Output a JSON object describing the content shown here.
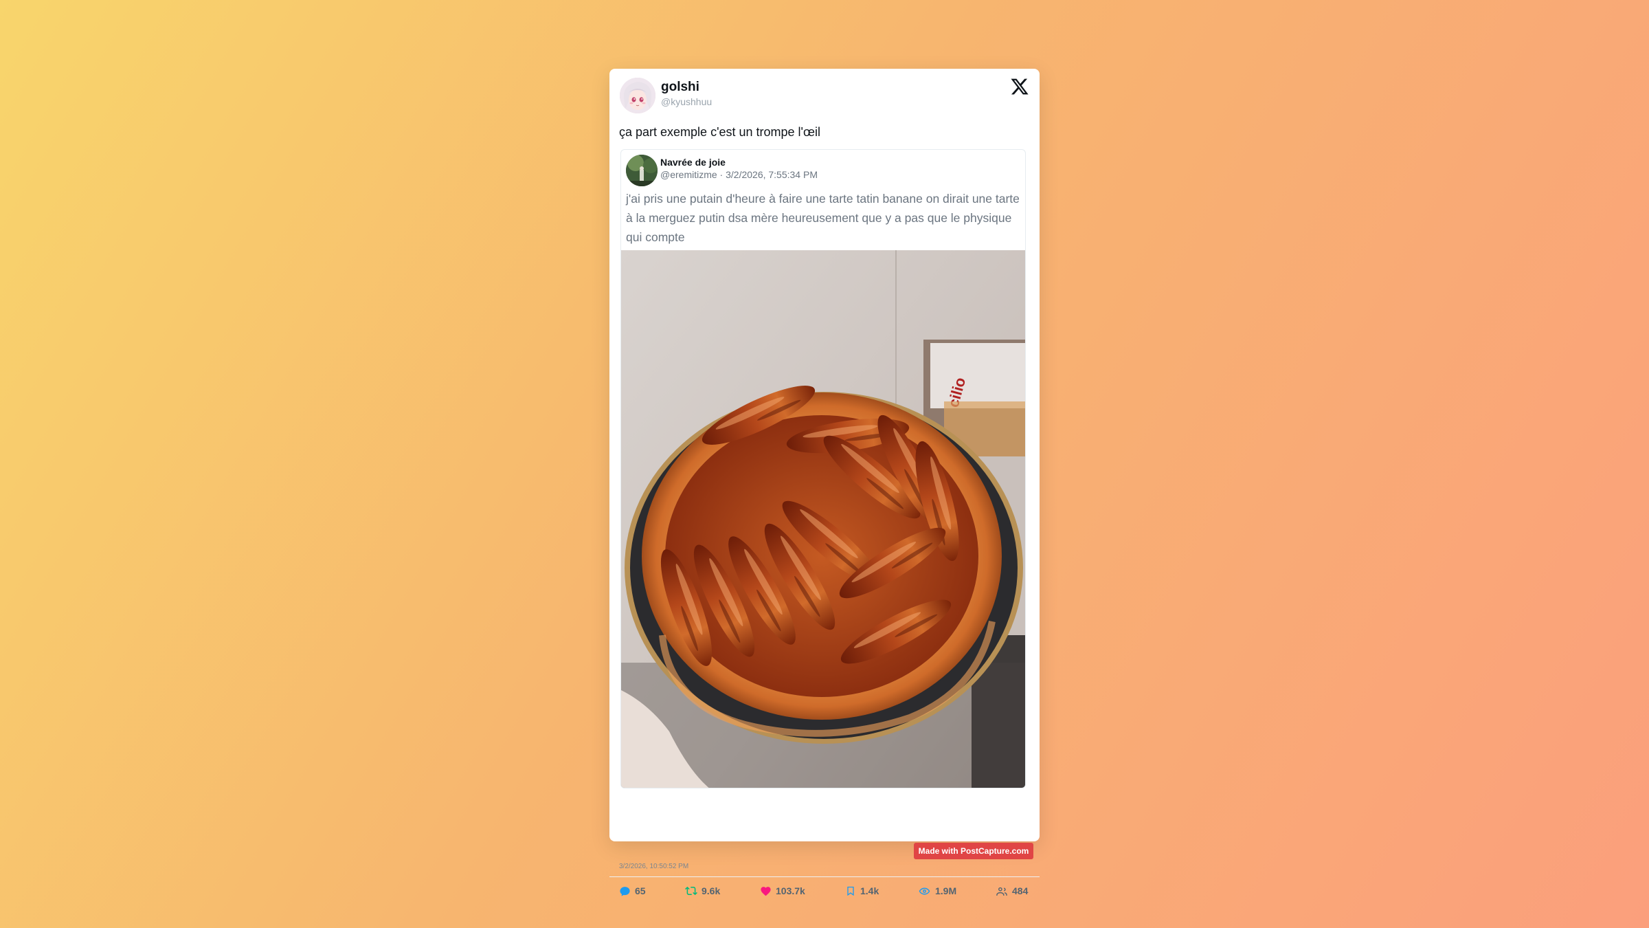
{
  "post": {
    "author_name": "golshi",
    "author_handle": "@kyushhuu",
    "text": "ça part exemple c'est un trompe l'œil",
    "timestamp": "3/2/2026, 10:50:52 PM",
    "platform_icon": "x-logo-icon"
  },
  "quoted": {
    "author_name": "Navrée de joie",
    "meta": "@eremitizme · 3/2/2026, 7:55:34 PM",
    "text": "j'ai pris une putain d'heure à faire une tarte tatin banane on dirait une tarte à la merguez putin dsa mère heureusement que y a pas que le physique qui compte",
    "image_alt": "banana tarte tatin in a round dish"
  },
  "stats": {
    "replies": "65",
    "reposts": "9.6k",
    "likes": "103.7k",
    "bookmarks": "1.4k",
    "views": "1.9M",
    "followers": "484"
  },
  "icons": {
    "replies": "comment-icon",
    "reposts": "repost-icon",
    "likes": "heart-icon",
    "bookmarks": "bookmark-icon",
    "views": "eye-icon",
    "followers": "users-icon"
  },
  "colors": {
    "reply": "#1d9bf0",
    "repost": "#00ba7c",
    "like": "#f91880",
    "badge": "#e04545"
  },
  "badge": "Made with PostCapture.com"
}
